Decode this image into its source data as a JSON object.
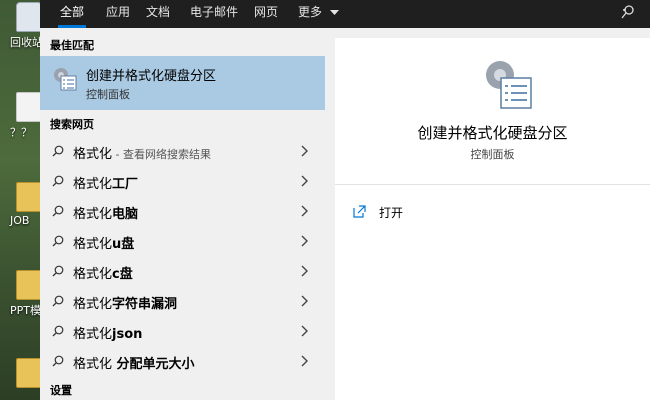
{
  "desktop": {
    "icons": [
      {
        "label": "回收站"
      },
      {
        "label": "？？"
      },
      {
        "label": "JOB"
      },
      {
        "label": "PPT模"
      },
      {
        "label": ""
      }
    ]
  },
  "tabs": [
    {
      "label": "全部",
      "active": true
    },
    {
      "label": "应用"
    },
    {
      "label": "文档"
    },
    {
      "label": "电子邮件"
    },
    {
      "label": "网页"
    },
    {
      "label": "更多"
    }
  ],
  "sections": {
    "best_match": "最佳匹配",
    "web_search": "搜索网页",
    "settings": "设置"
  },
  "best_match": {
    "title": "创建并格式化硬盘分区",
    "subtitle": "控制面板",
    "icon": "control-panel-icon"
  },
  "web_results": [
    {
      "base": "格式化",
      "bold": "",
      "hint": " - 查看网络搜索结果"
    },
    {
      "base": "格式化",
      "bold": "工厂",
      "hint": ""
    },
    {
      "base": "格式化",
      "bold": "电脑",
      "hint": ""
    },
    {
      "base": "格式化",
      "bold": "u盘",
      "hint": ""
    },
    {
      "base": "格式化",
      "bold": "c盘",
      "hint": ""
    },
    {
      "base": "格式化",
      "bold": "字符串漏洞",
      "hint": ""
    },
    {
      "base": "格式化",
      "bold": "json",
      "hint": ""
    },
    {
      "base": "格式化",
      "bold": " 分配单元大小",
      "hint": ""
    }
  ],
  "detail": {
    "title": "创建并格式化硬盘分区",
    "subtitle": "控制面板",
    "actions": [
      {
        "label": "打开",
        "icon": "open-icon"
      }
    ]
  },
  "colors": {
    "accent": "#0078d7",
    "selection": "#aacae3",
    "topbar": "#1f1f1f"
  }
}
